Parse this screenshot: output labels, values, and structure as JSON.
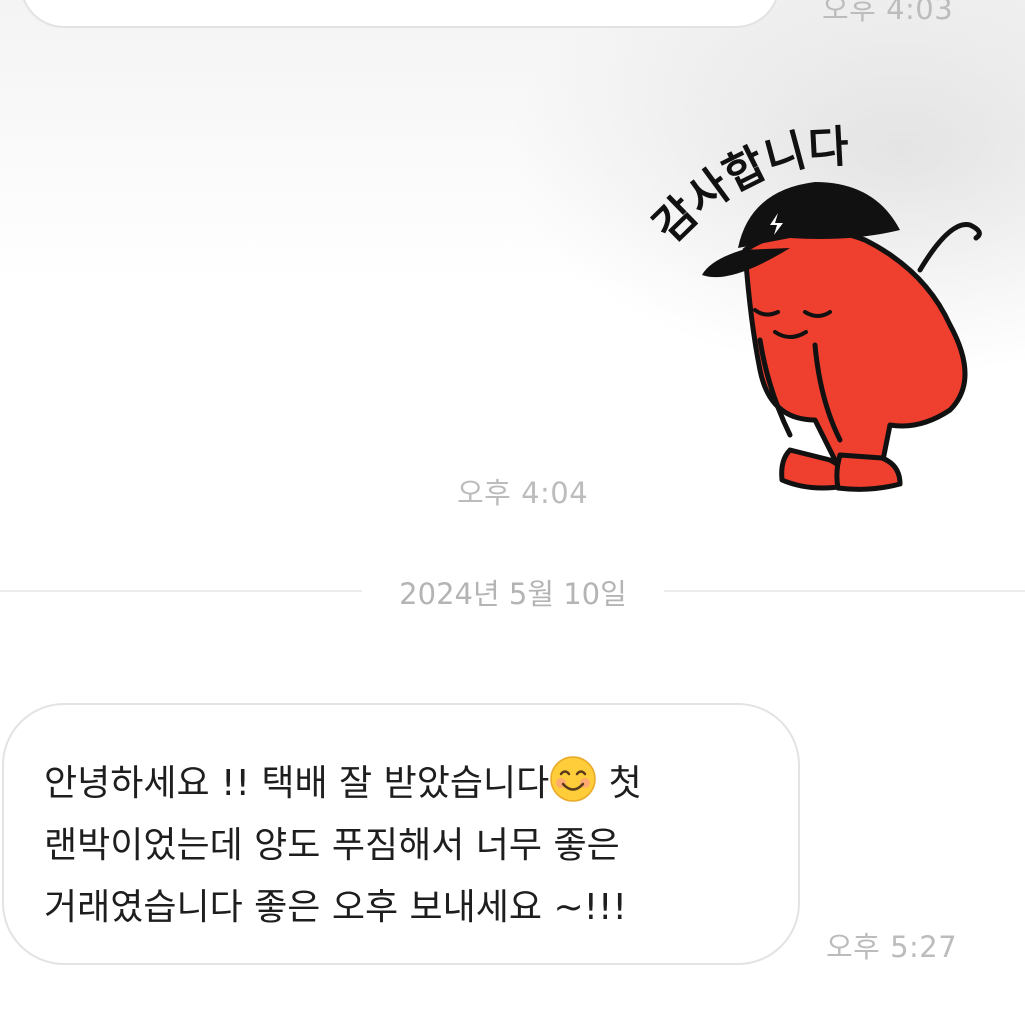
{
  "messages": {
    "prev_time": "오후 4:03",
    "sticker": {
      "caption": "감사합니다",
      "time": "오후 4:04"
    },
    "date_separator": "2024년 5월 10일",
    "incoming": {
      "lines": [
        {
          "before": "안녕하세요 !! 택배 잘 받았습니다",
          "emoji": "smiling-face-emoji",
          "after": " 첫"
        },
        {
          "text": "랜박이었는데 양도 푸짐해서 너무 좋은"
        },
        {
          "text": "거래였습니다 좋은 오후 보내세요 ~!!!"
        }
      ],
      "time": "오후 5:27"
    }
  },
  "colors": {
    "background": "#ffffff",
    "bubble_border": "#e3e3e3",
    "timestamp": "#bcbcbc",
    "sticker_body": "#ef3f2e",
    "sticker_cap": "#111111"
  }
}
